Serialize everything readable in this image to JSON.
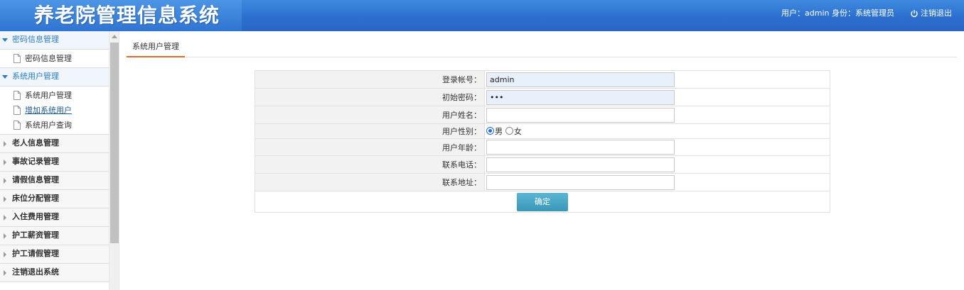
{
  "header": {
    "app_title": "养老院管理信息系统",
    "user_info": "用户：admin 身份：系统管理员",
    "logout_label": "注销退出"
  },
  "sidebar": {
    "groups": [
      {
        "label": "密码信息管理",
        "expanded": true,
        "items": [
          {
            "label": "密码信息管理"
          }
        ]
      },
      {
        "label": "系统用户管理",
        "expanded": true,
        "items": [
          {
            "label": "系统用户管理"
          },
          {
            "label": "增加系统用户",
            "active": true
          },
          {
            "label": "系统用户查询"
          }
        ]
      },
      {
        "label": "老人信息管理",
        "expanded": false
      },
      {
        "label": "事故记录管理",
        "expanded": false
      },
      {
        "label": "请假信息管理",
        "expanded": false
      },
      {
        "label": "床位分配管理",
        "expanded": false
      },
      {
        "label": "入住费用管理",
        "expanded": false
      },
      {
        "label": "护工薪资管理",
        "expanded": false
      },
      {
        "label": "护工请假管理",
        "expanded": false
      },
      {
        "label": "注销退出系统",
        "expanded": false
      }
    ]
  },
  "main": {
    "tab_label": "系统用户管理",
    "form": {
      "login_account": {
        "label": "登录帐号：",
        "value": "admin"
      },
      "initial_password": {
        "label": "初始密码：",
        "value": "•••"
      },
      "user_name": {
        "label": "用户姓名：",
        "value": ""
      },
      "gender": {
        "label": "用户性别：",
        "options": [
          "男",
          "女"
        ],
        "selected": "男"
      },
      "age": {
        "label": "用户年龄：",
        "value": ""
      },
      "phone": {
        "label": "联系电话：",
        "value": ""
      },
      "address": {
        "label": "联系地址：",
        "value": ""
      },
      "submit_label": "确定"
    }
  },
  "colors": {
    "header_blue": "#2c6fcf",
    "menu_active_blue": "#2a7cc2",
    "tab_underline": "#e06c2a",
    "button_teal": "#3a97b8"
  }
}
